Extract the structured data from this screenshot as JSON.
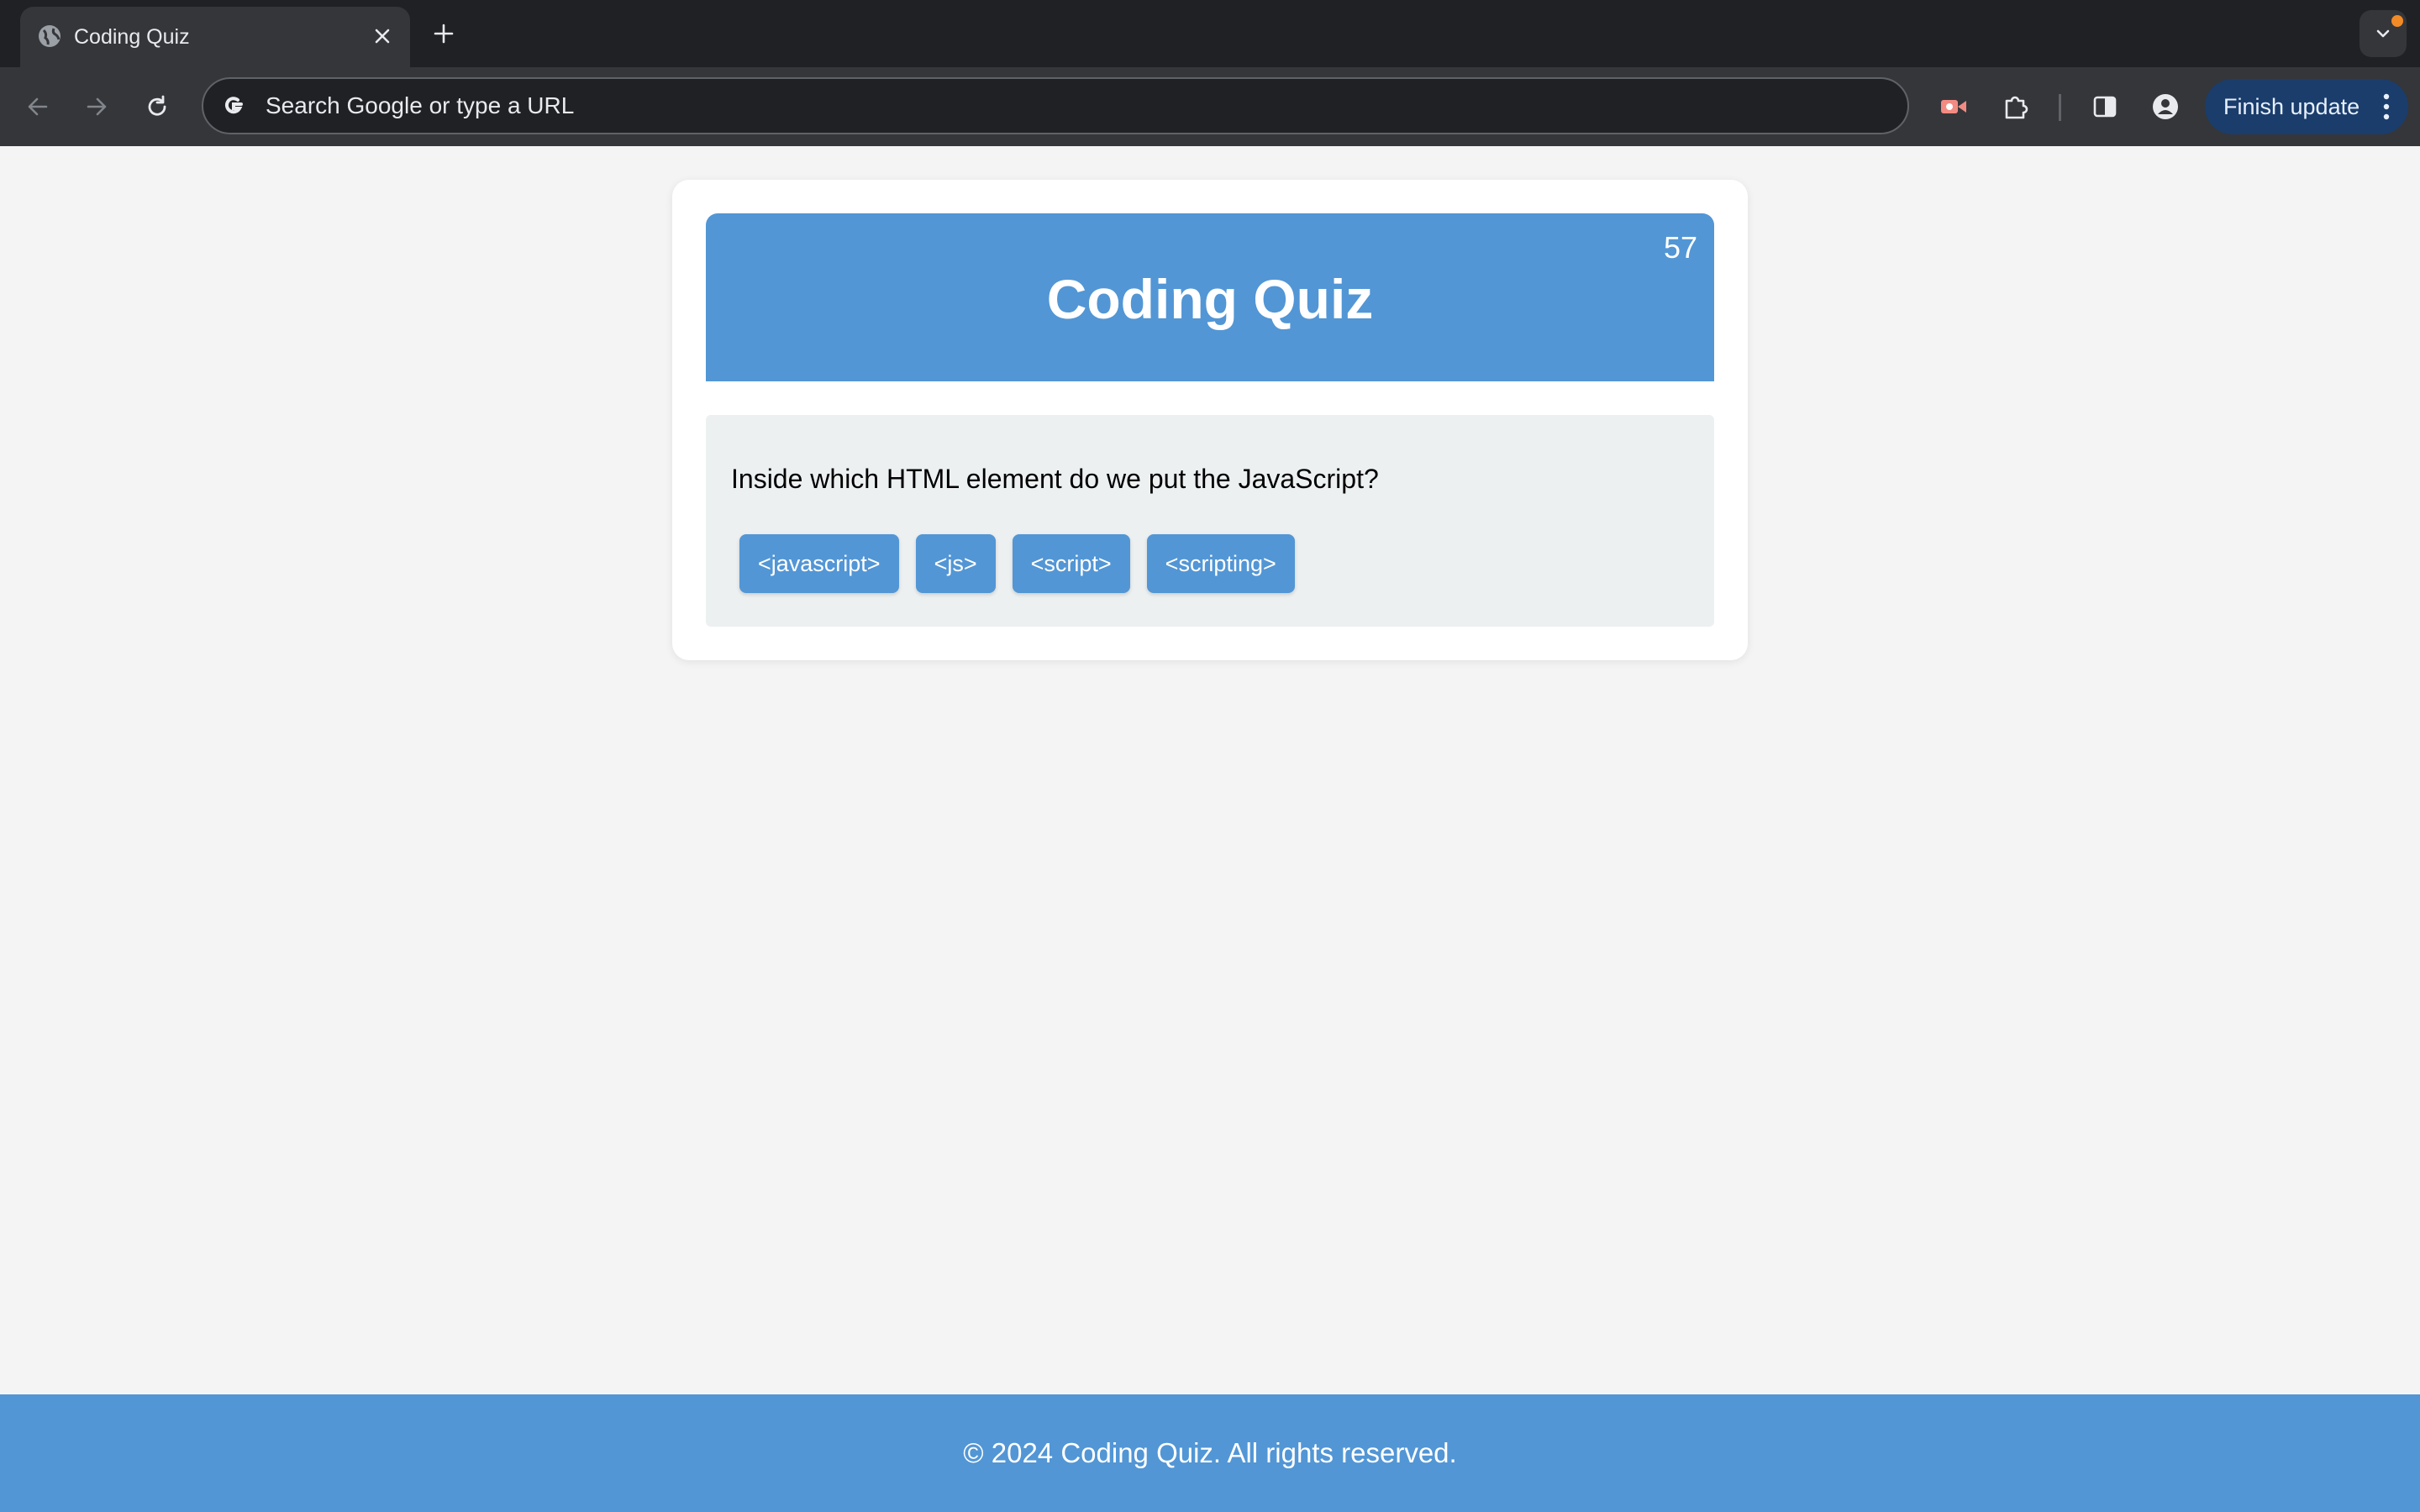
{
  "browser": {
    "tab_title": "Coding Quiz",
    "new_tab_icon": "plus-icon",
    "address_placeholder": "Search Google or type a URL",
    "finish_update_label": "Finish update"
  },
  "quiz": {
    "title": "Coding Quiz",
    "timer": "57",
    "question": "Inside which HTML element do we put the JavaScript?",
    "answers": [
      "<javascript>",
      "<js>",
      "<script>",
      "<scripting>"
    ]
  },
  "footer": {
    "text": "© 2024 Coding Quiz. All rights reserved."
  },
  "colors": {
    "accent": "#5296d5",
    "question_bg": "#ecf0f1",
    "page_bg": "#f4f4f4"
  }
}
